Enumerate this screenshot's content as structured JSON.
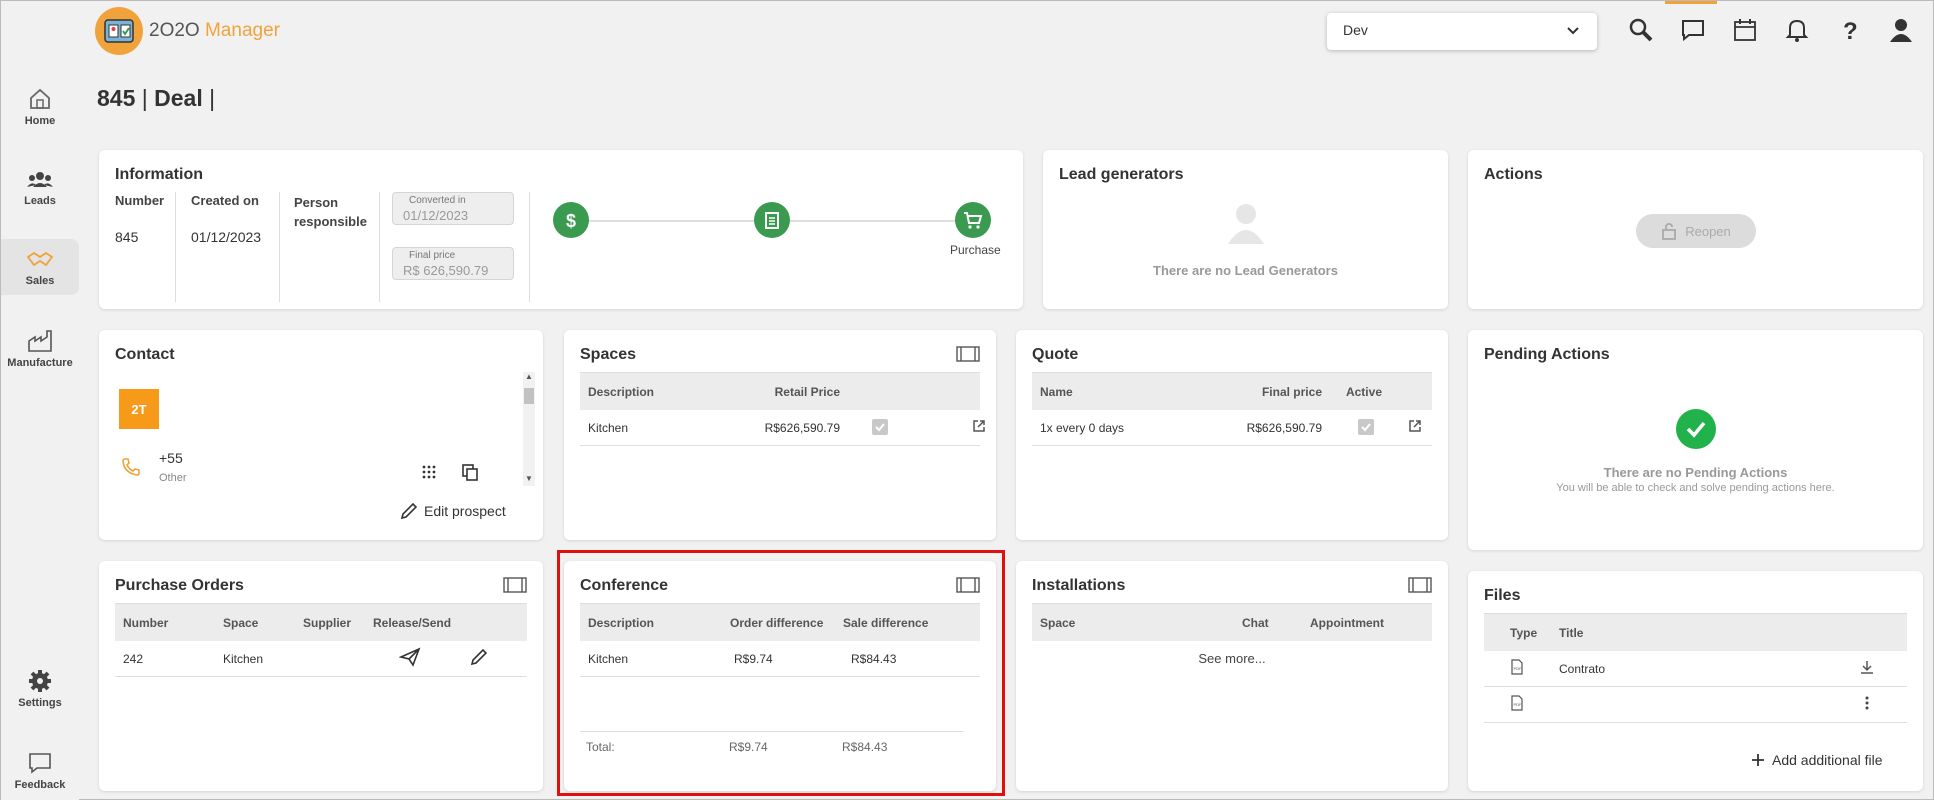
{
  "app": {
    "name_prefix": "2O2O",
    "name_suffix": "Manager"
  },
  "env_select": {
    "value": "Dev"
  },
  "sidebar": {
    "items": [
      {
        "label": "Home",
        "icon": "home-icon"
      },
      {
        "label": "Leads",
        "icon": "people-icon"
      },
      {
        "label": "Sales",
        "icon": "handshake-icon"
      },
      {
        "label": "Manufacture",
        "icon": "factory-icon"
      },
      {
        "label": "Settings",
        "icon": "gear-icon"
      },
      {
        "label": "Feedback",
        "icon": "feedback-icon"
      }
    ]
  },
  "page": {
    "title_number": "845",
    "title_sep": "|",
    "title_type": "Deal",
    "title_end": "|"
  },
  "information": {
    "title": "Information",
    "number_label": "Number",
    "number_value": "845",
    "created_label": "Created on",
    "created_value": "01/12/2023",
    "person_label": "Person responsible",
    "converted_label": "Converted in",
    "converted_value": "01/12/2023",
    "final_label": "Final price",
    "final_value": "R$ 626,590.79",
    "stage_label": "Purchase"
  },
  "lead_generators": {
    "title": "Lead generators",
    "empty": "There are no Lead Generators"
  },
  "actions": {
    "title": "Actions",
    "reopen": "Reopen"
  },
  "contact": {
    "title": "Contact",
    "avatar": "2T",
    "phone": "+55",
    "phone_type": "Other",
    "edit": "Edit prospect"
  },
  "spaces": {
    "title": "Spaces",
    "headers": [
      "Description",
      "Retail Price"
    ],
    "rows": [
      {
        "description": "Kitchen",
        "price": "R$626,590.79"
      }
    ]
  },
  "quote": {
    "title": "Quote",
    "headers": [
      "Name",
      "Final price",
      "Active"
    ],
    "rows": [
      {
        "name": "1x every 0 days",
        "price": "R$626,590.79"
      }
    ]
  },
  "pending_actions": {
    "title": "Pending Actions",
    "empty": "There are no Pending Actions",
    "sub": "You will be able to check and solve pending actions here."
  },
  "purchase_orders": {
    "title": "Purchase Orders",
    "headers": [
      "Number",
      "Space",
      "Supplier",
      "Release/Send"
    ],
    "rows": [
      {
        "number": "242",
        "space": "Kitchen",
        "supplier": ""
      }
    ]
  },
  "conference": {
    "title": "Conference",
    "headers": [
      "Description",
      "Order difference",
      "Sale difference"
    ],
    "rows": [
      {
        "description": "Kitchen",
        "order": "R$9.74",
        "sale": "R$84.43"
      }
    ],
    "total_label": "Total:",
    "total_order": "R$9.74",
    "total_sale": "R$84.43"
  },
  "installations": {
    "title": "Installations",
    "headers": [
      "Space",
      "Chat",
      "Appointment"
    ],
    "see_more": "See more..."
  },
  "files": {
    "title": "Files",
    "headers": [
      "Type",
      "Title"
    ],
    "rows": [
      {
        "title": "Contrato"
      },
      {
        "title": ""
      }
    ],
    "add": "Add additional file"
  },
  "colors": {
    "accent": "#f0a33a",
    "green": "#3a9a4f",
    "highlight": "#e01010"
  }
}
